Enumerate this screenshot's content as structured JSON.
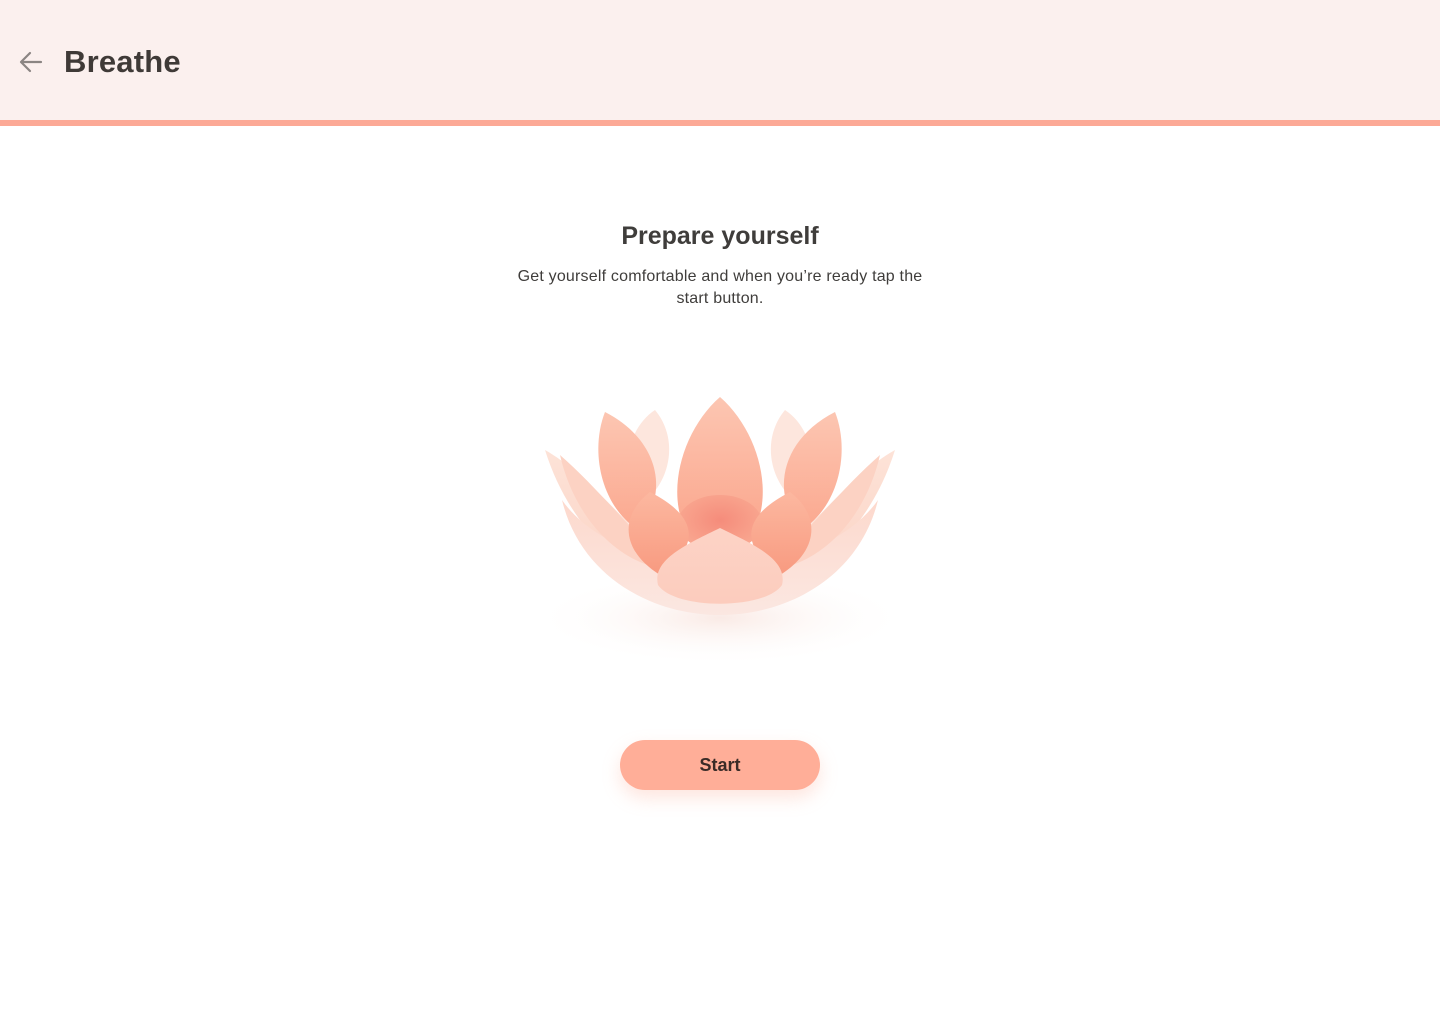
{
  "header": {
    "title": "Breathe",
    "back_icon": "arrow-left-icon",
    "background_color": "#fbf0ee",
    "accent_color": "#fca996"
  },
  "main": {
    "heading": "Prepare yourself",
    "description": "Get yourself comfortable and when you’re ready tap the start button.",
    "illustration_icon": "lotus-flower-icon",
    "start_button_label": "Start",
    "start_button_color": "#ffae98"
  }
}
